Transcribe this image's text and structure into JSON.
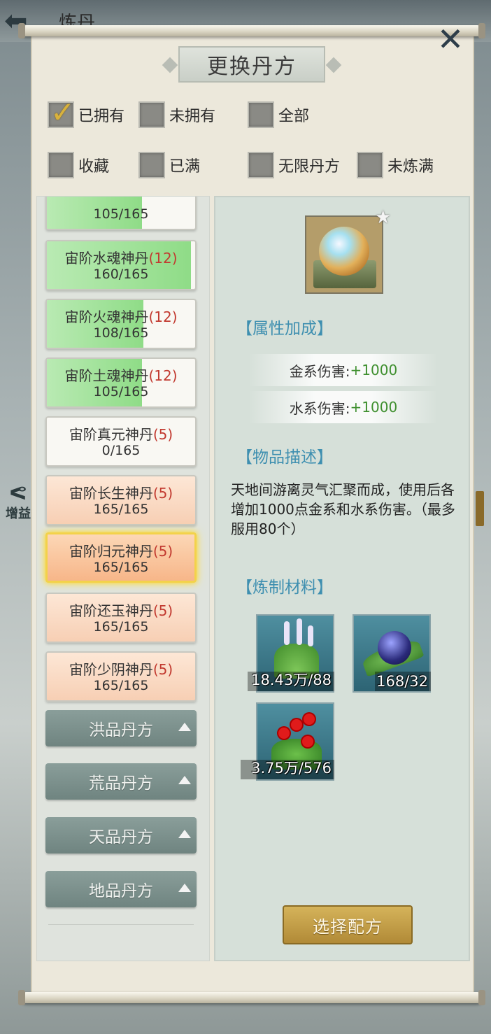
{
  "background": {
    "title": "炼丹",
    "side_label": "增益"
  },
  "dialog": {
    "title": "更换丹方"
  },
  "filters": [
    {
      "label": "已拥有",
      "checked": true
    },
    {
      "label": "未拥有",
      "checked": false
    },
    {
      "label": "全部",
      "checked": false
    },
    {
      "label": "收藏",
      "checked": false
    },
    {
      "label": "已满",
      "checked": false
    },
    {
      "label": "无限丹方",
      "checked": false
    },
    {
      "label": "未炼满",
      "checked": false
    }
  ],
  "recipes": [
    {
      "name": "",
      "level": "",
      "count": "105/165",
      "progress": 0.64,
      "style": "green"
    },
    {
      "name": "宙阶水魂神丹",
      "level": "(12)",
      "count": "160/165",
      "progress": 0.97,
      "style": "green"
    },
    {
      "name": "宙阶火魂神丹",
      "level": "(12)",
      "count": "108/165",
      "progress": 0.65,
      "style": "green"
    },
    {
      "name": "宙阶土魂神丹",
      "level": "(12)",
      "count": "105/165",
      "progress": 0.64,
      "style": "green"
    },
    {
      "name": "宙阶真元神丹",
      "level": "(5)",
      "count": "0/165",
      "progress": 0,
      "style": "white"
    },
    {
      "name": "宙阶长生神丹",
      "level": "(5)",
      "count": "165/165",
      "progress": 1,
      "style": "orange"
    },
    {
      "name": "宙阶归元神丹",
      "level": "(5)",
      "count": "165/165",
      "progress": 1,
      "style": "selected"
    },
    {
      "name": "宙阶还玉神丹",
      "level": "(5)",
      "count": "165/165",
      "progress": 1,
      "style": "orange"
    },
    {
      "name": "宙阶少阴神丹",
      "level": "(5)",
      "count": "165/165",
      "progress": 1,
      "style": "orange"
    }
  ],
  "categories": [
    {
      "label": "洪品丹方"
    },
    {
      "label": "荒品丹方"
    },
    {
      "label": "天品丹方"
    },
    {
      "label": "地品丹方"
    }
  ],
  "detail": {
    "attr_title": "【属性加成】",
    "attributes": [
      {
        "label": "金系伤害: ",
        "value": "+1000"
      },
      {
        "label": "水系伤害: ",
        "value": "+1000"
      }
    ],
    "desc_title": "【物品描述】",
    "description": "天地间游离灵气汇聚而成，使用后各增加1000点金系和水系伤害。（最多服用80个）",
    "material_title": "【炼制材料】",
    "materials": [
      {
        "count": "18.43万/88",
        "icon": "lavender-herb-icon"
      },
      {
        "count": "168/32",
        "icon": "blue-berry-icon"
      },
      {
        "count": "3.75万/576",
        "icon": "red-flower-icon"
      }
    ],
    "select_button": "选择配方"
  }
}
